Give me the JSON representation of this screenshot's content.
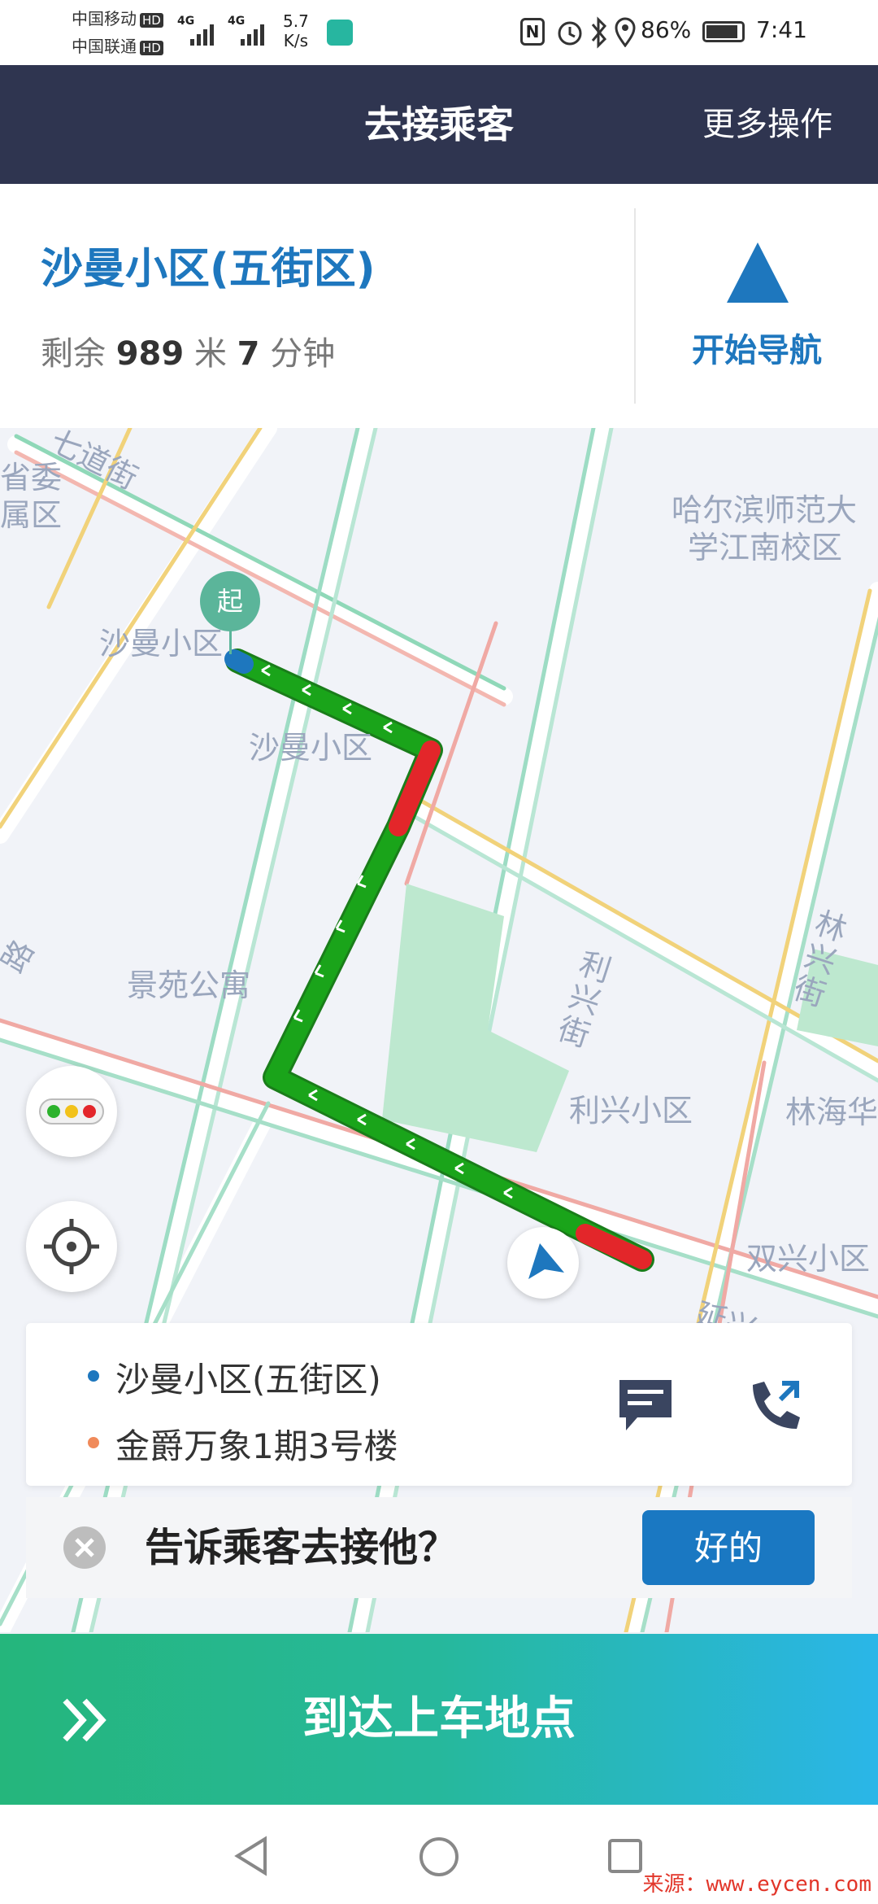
{
  "status_bar": {
    "carrier1": "中国移动",
    "carrier2": "中国联通",
    "hd": "HD",
    "net_type": "4G",
    "speed_value": "5.7",
    "speed_unit": "K/s",
    "battery": "86%",
    "time": "7:41"
  },
  "header": {
    "title": "去接乘客",
    "more_actions": "更多操作"
  },
  "destination": {
    "name": "沙曼小区(五街区)",
    "remaining_prefix": "剩余",
    "distance_value": "989",
    "distance_unit": "米",
    "time_value": "7",
    "time_unit": "分钟",
    "nav_label": "开始导航"
  },
  "map": {
    "labels": {
      "street_top": "七道街",
      "area_left": "省委",
      "area_left2": "属区",
      "university": "哈尔滨师范大",
      "university2": "学江南校区",
      "start_marker": "起",
      "shaman1": "沙曼小区",
      "shaman2": "沙曼小区",
      "jingyuan": "景苑公寓",
      "road_left": "路",
      "lixing_street": "利兴街",
      "linxing_street": "林兴街",
      "lixing_area": "利兴小区",
      "linhai": "林海华",
      "shuangxing": "双兴小区",
      "yanxing": "延兴"
    }
  },
  "trip": {
    "pickup": "沙曼小区(五街区)",
    "dropoff": "金爵万象1期3号楼",
    "pickup_color": "#1e77be",
    "dropoff_color": "#f08a5a"
  },
  "prompt": {
    "text": "告诉乘客去接他？",
    "ok_label": "好的"
  },
  "arrive": {
    "label": "到达上车地点"
  },
  "watermark": "来源：www.eycen.com",
  "colors": {
    "header_bg": "#2f3550",
    "accent": "#1e77be",
    "route_green": "#1aa41a",
    "route_red": "#e3262a"
  }
}
